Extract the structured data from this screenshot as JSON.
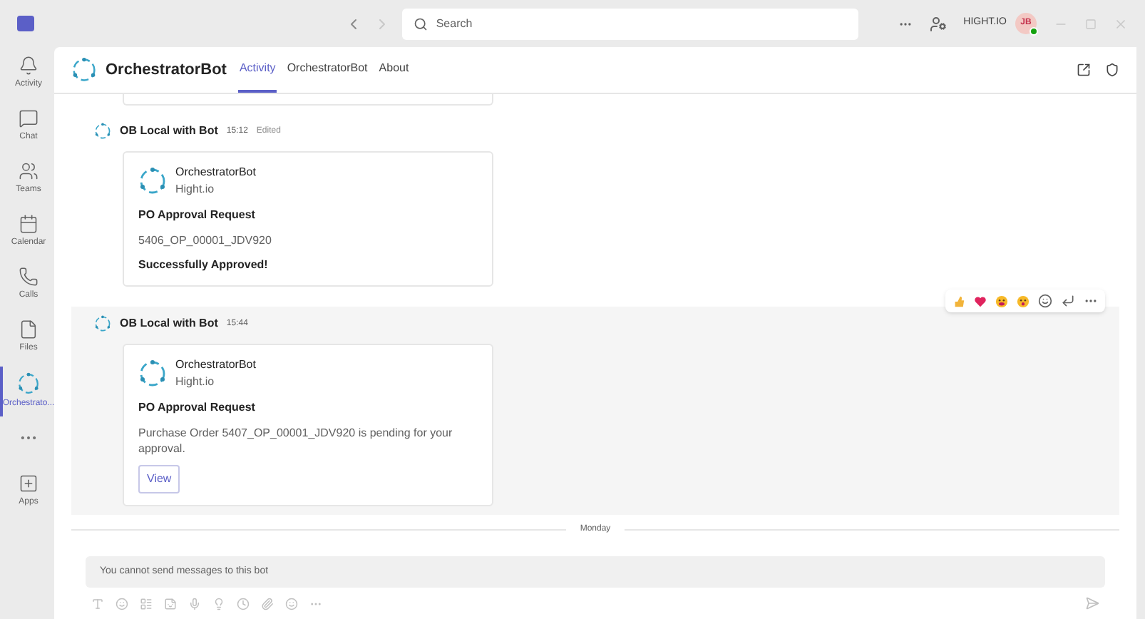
{
  "titlebar": {
    "search": {
      "placeholder": "Search"
    },
    "org": "HIGHT.IO",
    "avatar": "JB"
  },
  "rail": [
    {
      "label": "Activity",
      "selected": false
    },
    {
      "label": "Chat",
      "selected": false
    },
    {
      "label": "Teams",
      "selected": false
    },
    {
      "label": "Calendar",
      "selected": false
    },
    {
      "label": "Calls",
      "selected": false
    },
    {
      "label": "Files",
      "selected": false
    },
    {
      "label": "Orchestrato...",
      "selected": true
    },
    {
      "selected": false
    },
    {
      "label": "Apps",
      "selected": false
    }
  ],
  "header": {
    "title": "OrchestratorBot",
    "tabs": [
      {
        "label": "Activity",
        "selected": true
      },
      {
        "label": "OrchestratorBot",
        "selected": false
      },
      {
        "label": "About",
        "selected": false
      }
    ]
  },
  "messages": [
    {
      "sender": "OB Local with Bot",
      "time": "15:12",
      "edited": "Edited",
      "highlighted": false,
      "card": {
        "bot": "OrchestratorBot",
        "org": "Hight.io",
        "title": "PO Approval Request",
        "body": "5406_OP_00001_JDV920",
        "status": "Successfully Approved!"
      }
    },
    {
      "sender": "OB Local with Bot",
      "time": "15:44",
      "highlighted": true,
      "card": {
        "bot": "OrchestratorBot",
        "org": "Hight.io",
        "title": "PO Approval Request",
        "body": "Purchase Order 5407_OP_00001_JDV920 is pending for your approval.",
        "button": "View"
      }
    }
  ],
  "divider": "Monday",
  "compose": {
    "placeholder": "You cannot send messages to this bot"
  }
}
